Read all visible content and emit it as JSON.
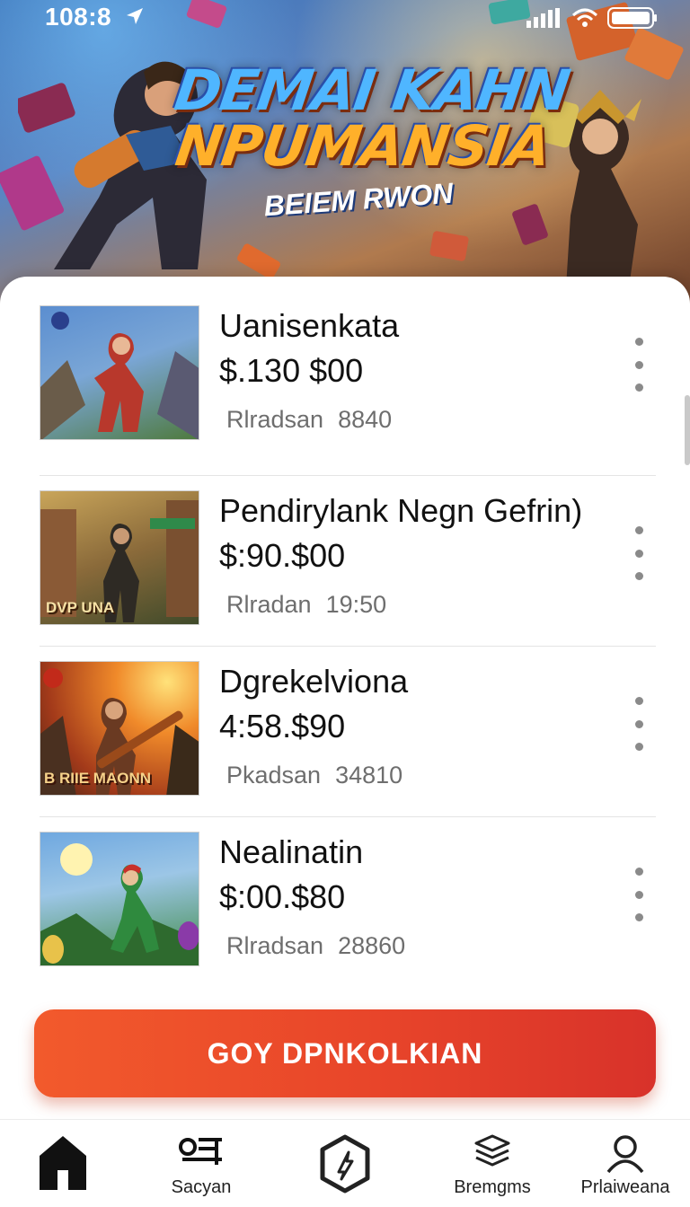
{
  "status_bar": {
    "time": "108:8"
  },
  "hero": {
    "title_line1": "DEMAI KAHN",
    "title_line2": "NPUMANSIA",
    "subtitle": "BEIEM RWON"
  },
  "games": [
    {
      "title": "Uanisenkata",
      "price": "$.130 $00",
      "meta_label": "Rlradsan",
      "meta_value": "8840",
      "thumb_text": "",
      "thumb_colors": [
        "#3b6aa8",
        "#c23b2c",
        "#6fa35a"
      ]
    },
    {
      "title": "Pendirylank Negn Gefrin)",
      "price": "$:90.$00",
      "meta_label": "Rlradan",
      "meta_value": "19:50",
      "thumb_text": "DVP UNA",
      "thumb_colors": [
        "#9a7a3e",
        "#3e4a2e",
        "#c9a454"
      ]
    },
    {
      "title": "Dgrekelviona",
      "price": "4:58.$90",
      "meta_label": "Pkadsan",
      "meta_value": "34810",
      "thumb_text": "B RIIE MAONN",
      "thumb_colors": [
        "#d9621f",
        "#5a2a16",
        "#ffb23a"
      ]
    },
    {
      "title": "Nealinatin",
      "price": "$:00.$80",
      "meta_label": "Rlradsan",
      "meta_value": "28860",
      "thumb_text": "",
      "thumb_colors": [
        "#4a8cc9",
        "#2f7a3a",
        "#e9c24a"
      ]
    }
  ],
  "cta": {
    "label": "GOY DPNKOLKIAN"
  },
  "tabbar": {
    "items": [
      {
        "label": "",
        "icon": "home-icon"
      },
      {
        "label": "Sacyan",
        "icon": "list-icon"
      },
      {
        "label": "",
        "icon": "hexagon-icon"
      },
      {
        "label": "Bremgms",
        "icon": "stack-icon"
      },
      {
        "label": "Prlaiweana",
        "icon": "profile-icon"
      }
    ]
  },
  "colors": {
    "accent": "#e8452a",
    "text": "#111111",
    "muted": "#6e6e6e"
  }
}
